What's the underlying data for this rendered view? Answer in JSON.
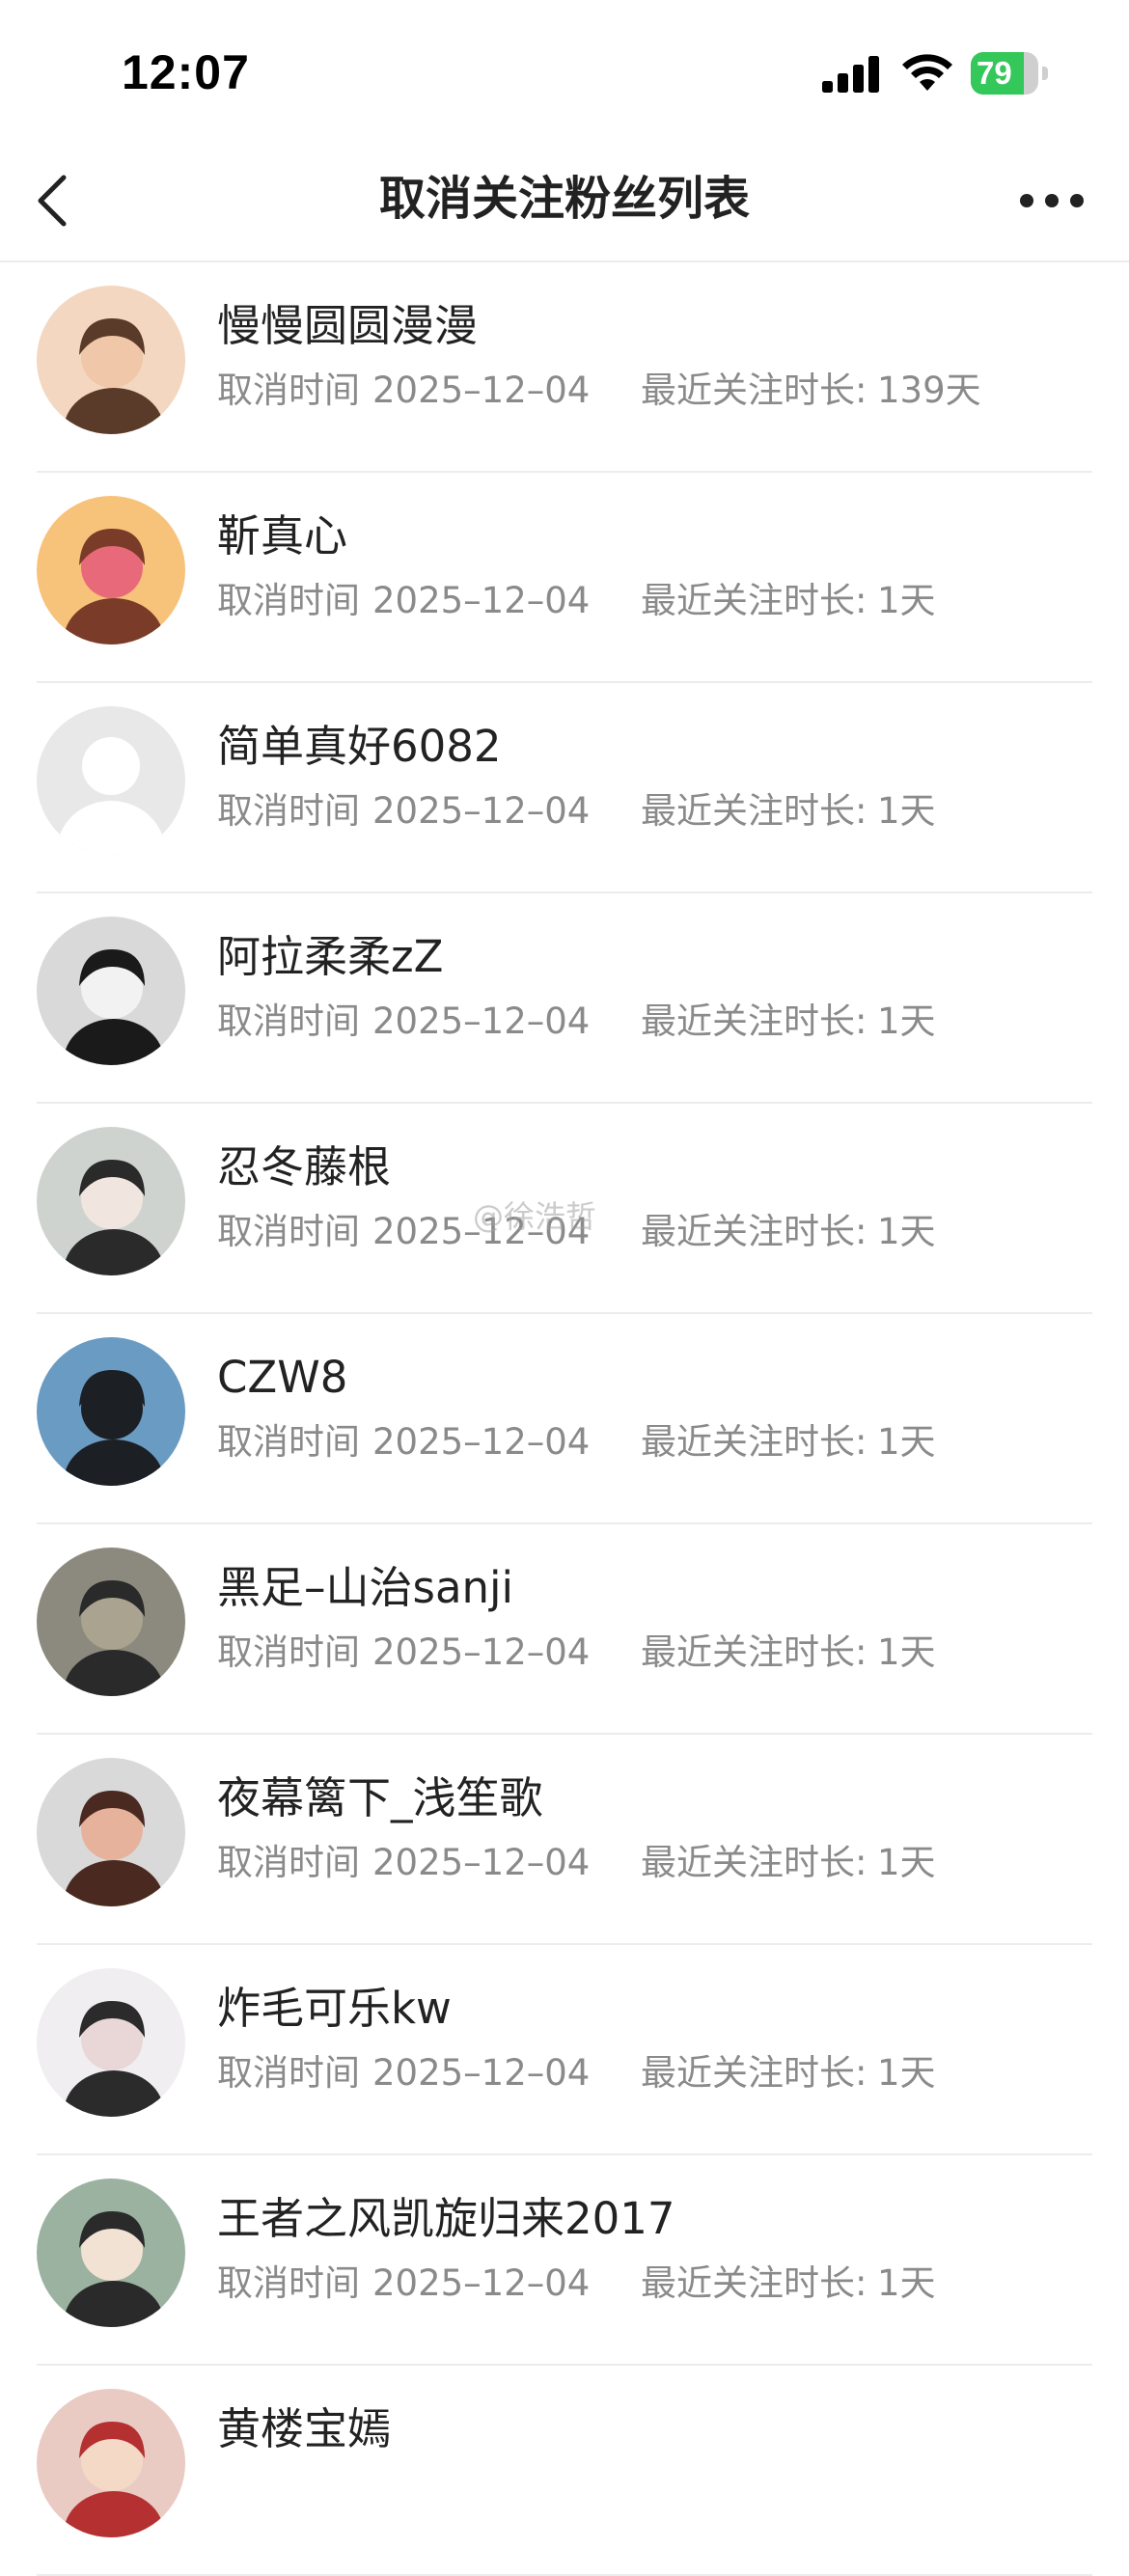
{
  "status_bar": {
    "time": "12:07",
    "battery_percent": 79,
    "battery_label": "79"
  },
  "nav": {
    "title": "取消关注粉丝列表",
    "back_icon": "chevron-left-icon",
    "more_icon": "more-horizontal-icon"
  },
  "list": {
    "cancel_label": "取消时间",
    "duration_label": "最近关注时长:",
    "items": [
      {
        "name": "慢慢圆圆漫漫",
        "cancel_date": "2025–12–04",
        "duration": "139天"
      },
      {
        "name": "靳真心",
        "cancel_date": "2025–12–04",
        "duration": "1天"
      },
      {
        "name": "简单真好6082",
        "cancel_date": "2025–12–04",
        "duration": "1天"
      },
      {
        "name": "阿拉柔柔zZ",
        "cancel_date": "2025–12–04",
        "duration": "1天"
      },
      {
        "name": "忍冬藤根",
        "cancel_date": "2025–12–04",
        "duration": "1天"
      },
      {
        "name": "CZW8",
        "cancel_date": "2025–12–04",
        "duration": "1天"
      },
      {
        "name": "黑足–山治sanji",
        "cancel_date": "2025–12–04",
        "duration": "1天"
      },
      {
        "name": "夜幕篱下_浅笙歌",
        "cancel_date": "2025–12–04",
        "duration": "1天"
      },
      {
        "name": "炸毛可乐kw",
        "cancel_date": "2025–12–04",
        "duration": "1天"
      },
      {
        "name": "王者之风凯旋归来2017",
        "cancel_date": "2025–12–04",
        "duration": "1天"
      },
      {
        "name": "黄楼宝嫣",
        "cancel_date": "",
        "duration": ""
      }
    ]
  },
  "watermark": "@徐浩哲",
  "colors": {
    "battery_green": "#34c759",
    "text_primary": "#222222",
    "text_secondary": "#8a8a8a",
    "divider": "#ececec"
  }
}
